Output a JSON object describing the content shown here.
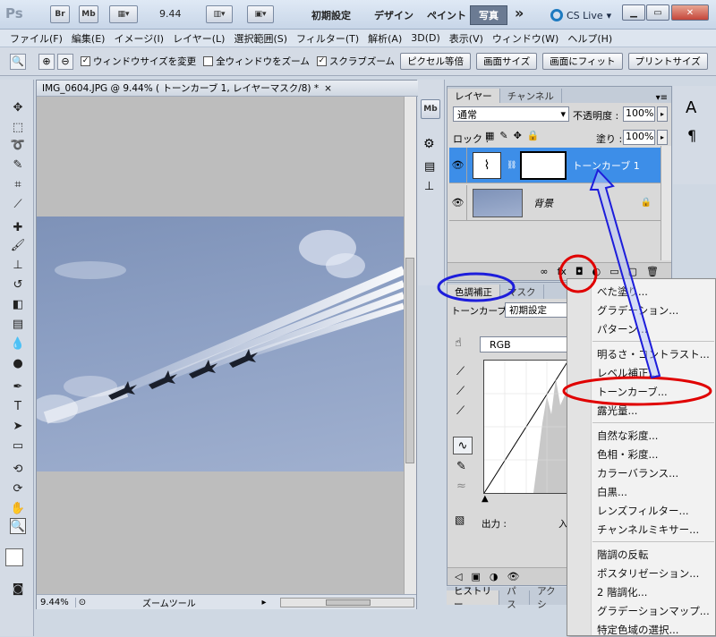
{
  "titlebar": {
    "app_logo": "Ps",
    "bridge": "Br",
    "minibridge": "Mb",
    "zoom": "9.44",
    "workspace_essentials": "初期設定",
    "workspace_design": "デザイン",
    "workspace_paint": "ペイント",
    "workspace_photo": "写真",
    "more": "»",
    "cs_live": "CS Live",
    "cs_live_arrow": "▾"
  },
  "menubar": {
    "items": [
      "ファイル(F)",
      "編集(E)",
      "イメージ(I)",
      "レイヤー(L)",
      "選択範囲(S)",
      "フィルター(T)",
      "解析(A)",
      "3D(D)",
      "表示(V)",
      "ウィンドウ(W)",
      "ヘルプ(H)"
    ]
  },
  "options": {
    "resize_windows": "ウィンドウサイズを変更",
    "zoom_all": "全ウィンドウをズーム",
    "scrubby_zoom": "スクラブズーム",
    "actual_pixels": "ピクセル等倍",
    "fit_screen": "画面サイズ",
    "fill_screen": "画面にフィット",
    "print_size": "プリントサイズ"
  },
  "document": {
    "tab_title": "IMG_0604.JPG @ 9.44% ( トーンカーブ 1, レイヤーマスク/8) *",
    "close": "×",
    "zoom": "9.44%",
    "status_tool": "ズームツール"
  },
  "layers_panel": {
    "tab_layers": "レイヤー",
    "tab_channels": "チャンネル",
    "blend_mode": "通常",
    "opacity_label": "不透明度 :",
    "opacity_value": "100%",
    "lock_label": "ロック :",
    "fill_label": "塗り :",
    "fill_value": "100%",
    "layers": [
      {
        "name": "トーンカーブ 1"
      },
      {
        "name": "背景"
      }
    ]
  },
  "adjust_panel": {
    "tab_adjustments": "色調補正",
    "tab_masks": "マスク",
    "preset_label": "トーンカーブ",
    "preset_value": "初期設定",
    "channel": "RGB",
    "output_label": "出力 :",
    "input_label": "入"
  },
  "dropdown": {
    "items": [
      "べた塗り...",
      "グラデーション...",
      "パターン...",
      "明るさ・コントラスト...",
      "レベル補正...",
      "トーンカーブ...",
      "露光量...",
      "自然な彩度...",
      "色相・彩度...",
      "カラーバランス...",
      "白黒...",
      "レンズフィルター...",
      "チャンネルミキサー...",
      "階調の反転",
      "ポスタリゼーション...",
      "2 階調化...",
      "グラデーションマップ...",
      "特定色域の選択..."
    ]
  },
  "history_tabs": {
    "history": "ヒストリー",
    "paths": "パス",
    "actions": "アクシ"
  },
  "colors": {
    "accent_selected": "#3d8ee8",
    "annotation_red": "#e00000",
    "annotation_blue": "#1d1ddb"
  }
}
